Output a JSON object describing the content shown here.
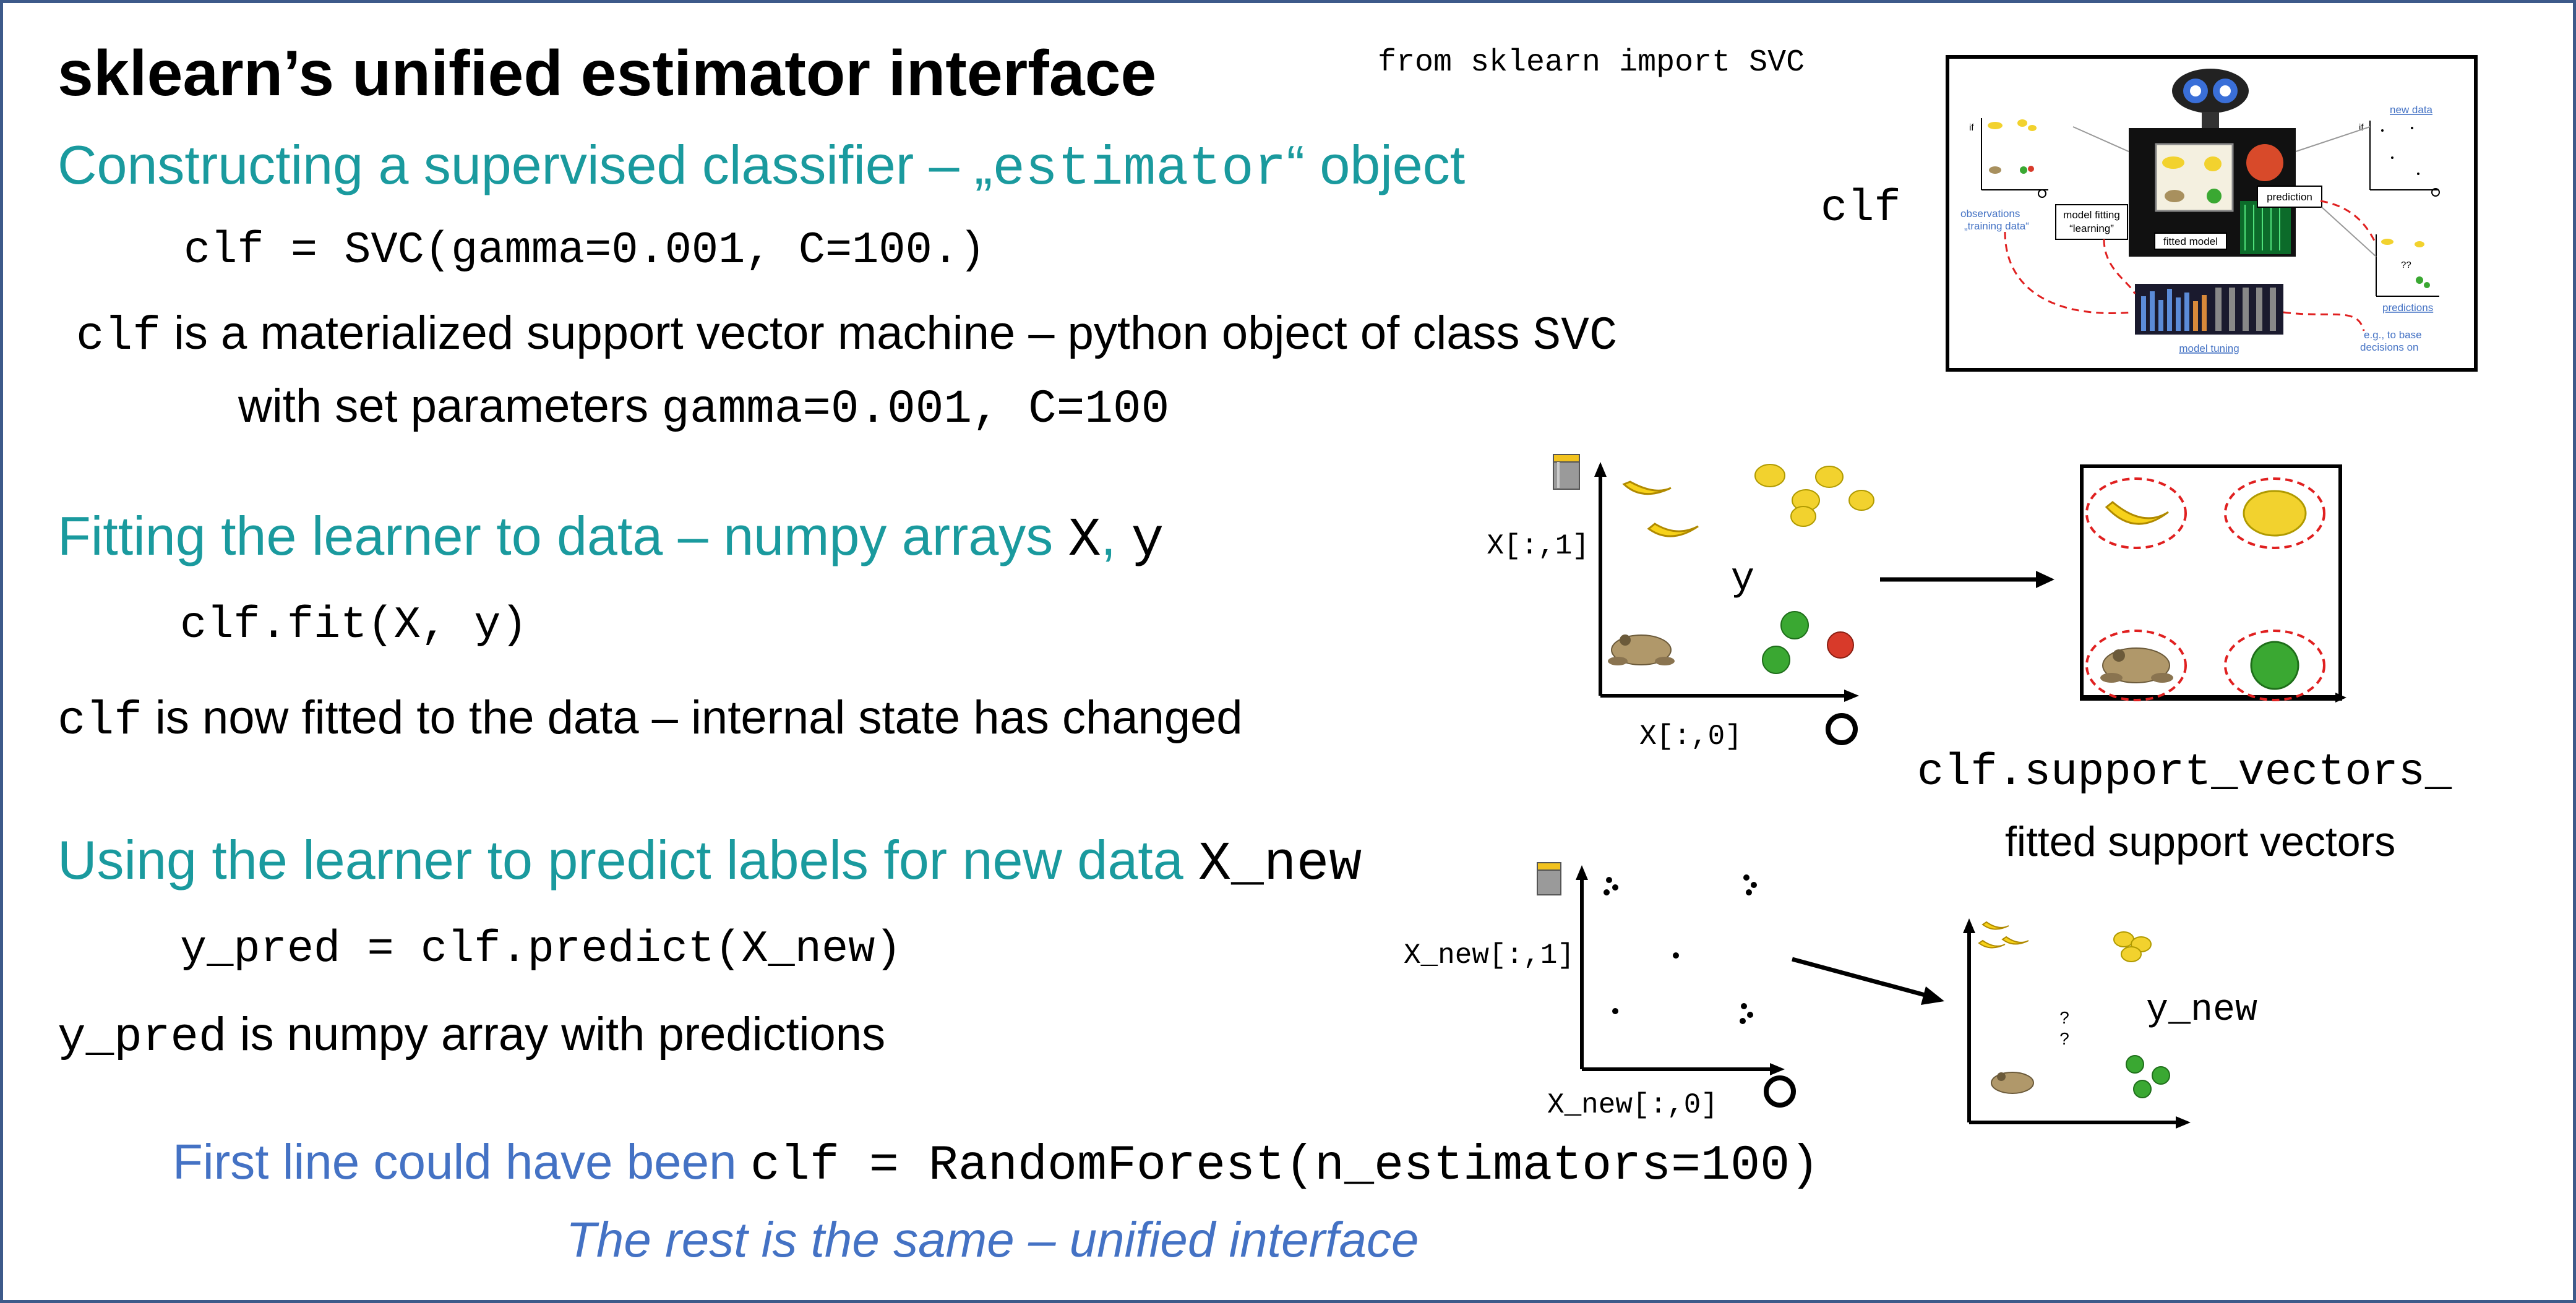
{
  "colors": {
    "heading": "#1a9a9e",
    "note": "#4472c4",
    "border": "#3d5a8a",
    "circle": "#e02020"
  },
  "title": "sklearn’s unified estimator interface",
  "import_line": "from sklearn import SVC",
  "clf_label": "clf",
  "section1": {
    "heading_text": "Constructing a supervised classifier – „",
    "heading_code": "estimator",
    "heading_end": "“ object",
    "code": "clf = SVC(gamma=0.001, C=100.)",
    "desc_code": "clf",
    "desc_text": "is a materialized support vector machine – python object of class",
    "desc_class": "SVC",
    "desc2_text": "with set parameters",
    "desc2_code": "gamma=0.001, C=100"
  },
  "section2": {
    "heading_text": "Fitting the learner to data – numpy arrays",
    "heading_x": "X",
    "heading_comma": ",",
    "heading_y": "y",
    "code": "clf.fit(X, y)",
    "desc_code": "clf",
    "desc_text": "is now fitted to the data – internal state has changed"
  },
  "section3": {
    "heading_text": "Using the learner to predict labels for new data",
    "heading_code": "X_new",
    "code": "y_pred = clf.predict(X_new)",
    "desc_code": "y_pred",
    "desc_text": "is numpy array with predictions"
  },
  "footer": {
    "line1_text": "First line could have been",
    "line1_code": "clf = RandomForest(n_estimators=100)",
    "line2": "The rest is the same – unified interface"
  },
  "plot_fit": {
    "ylabel": "X[:,1]",
    "xlabel": "X[:,0]",
    "label": "y"
  },
  "support_vectors": {
    "code": "clf.support_vectors_",
    "caption": "fitted support vectors"
  },
  "plot_new": {
    "ylabel": "X_new[:,1]",
    "xlabel": "X_new[:,0]"
  },
  "plot_pred": {
    "label": "y_new",
    "question_marks": "?"
  },
  "thumbnail": {
    "observations": "observations",
    "training_data": "„training data“",
    "model_fitting": "model fitting",
    "learning": "“learning”",
    "fitted_model": "fitted model",
    "prediction": "prediction",
    "new_data": "new data",
    "predictions": "predictions",
    "model_tuning": "model tuning",
    "eg_line1": "e.g., to base",
    "eg_line2": "decisions on",
    "if_label": "if",
    "qq": "??"
  }
}
